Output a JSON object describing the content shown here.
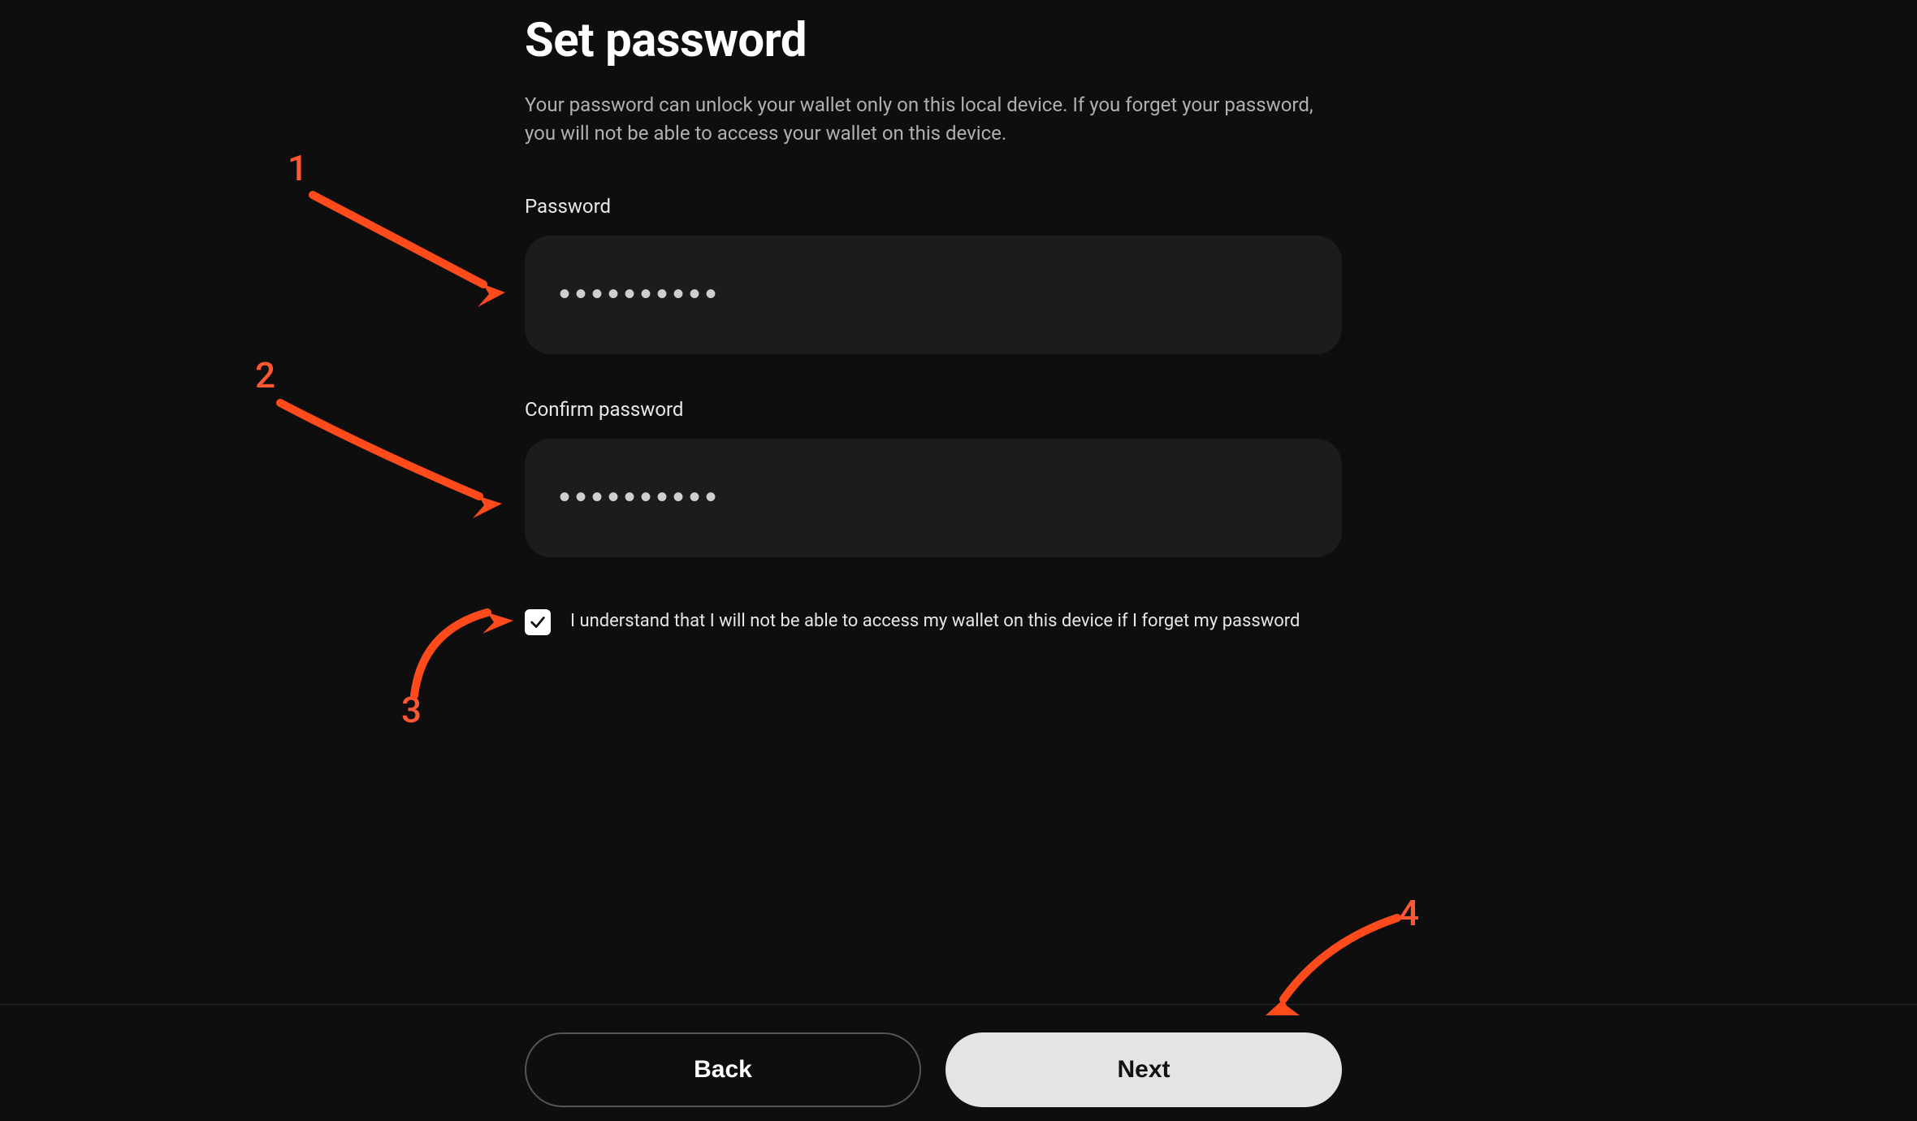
{
  "page": {
    "title": "Set password",
    "subtitle": "Your password can unlock your wallet only on this local device. If you forget your password, you will not be able to access your wallet on this device."
  },
  "fields": {
    "password_label": "Password",
    "password_value": "••••••••••",
    "confirm_label": "Confirm password",
    "confirm_value": "••••••••••"
  },
  "checkbox": {
    "label": "I understand that I will not be able to access my wallet on this device if I forget my password",
    "checked": true
  },
  "buttons": {
    "back": "Back",
    "next": "Next"
  },
  "annotations": {
    "n1": "1",
    "n2": "2",
    "n3": "3",
    "n4": "4"
  }
}
